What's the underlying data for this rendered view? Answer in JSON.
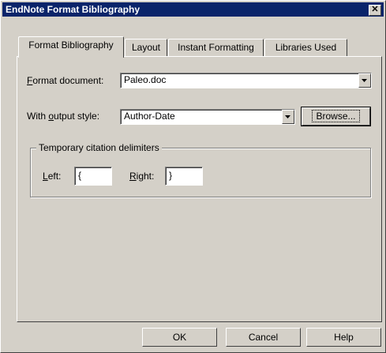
{
  "window": {
    "title": "EndNote Format Bibliography",
    "close_glyph": "✕"
  },
  "tabs": [
    {
      "label": "Format Bibliography",
      "active": true
    },
    {
      "label": "Layout"
    },
    {
      "label": "Instant Formatting"
    },
    {
      "label": "Libraries Used"
    }
  ],
  "format_document": {
    "label_access": "F",
    "label_rest": "ormat document:",
    "value": "Paleo.doc"
  },
  "output_style": {
    "label_pre": "With ",
    "label_access": "o",
    "label_rest": "utput style:",
    "value": "Author-Date",
    "browse_label": "Browse..."
  },
  "delimiters": {
    "group_label": "Temporary citation delimiters",
    "left_access": "L",
    "left_rest": "eft:",
    "left_value": "{",
    "right_access": "R",
    "right_rest": "ight:",
    "right_value": "}"
  },
  "footer": {
    "ok": "OK",
    "cancel": "Cancel",
    "help": "Help"
  },
  "icons": {
    "close": "close-icon",
    "dropdown": "chevron-down-icon"
  }
}
